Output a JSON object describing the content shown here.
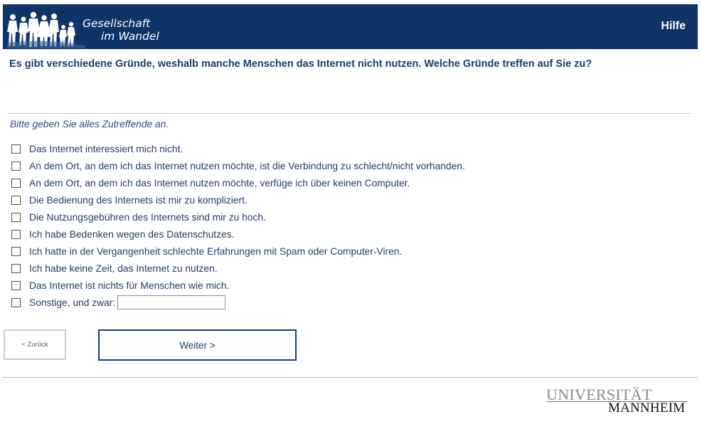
{
  "header": {
    "logo_line1": "Gesellschaft",
    "logo_line2": "im Wandel",
    "help_label": "Hilfe",
    "background_color": "#0e3367"
  },
  "question": {
    "text": "Es gibt verschiedene Gründe, weshalb manche Menschen das Internet nicht nutzen. Welche Gründe treffen auf Sie zu?",
    "hint": "Bitte geben Sie alles Zutreffende an."
  },
  "options": [
    {
      "label": "Das Internet interessiert mich nicht.",
      "checked": false
    },
    {
      "label": "An dem Ort, an dem ich das Internet nutzen möchte, ist die Verbindung zu schlecht/nicht vorhanden.",
      "checked": false
    },
    {
      "label": "An dem Ort, an dem ich das Internet nutzen möchte, verfüge ich über keinen Computer.",
      "checked": false
    },
    {
      "label": "Die Bedienung des Internets ist mir zu kompliziert.",
      "checked": false
    },
    {
      "label": "Die Nutzungsgebühren des Internets sind mir zu hoch.",
      "checked": false
    },
    {
      "label": "Ich habe Bedenken wegen des Datenschutzes.",
      "checked": false
    },
    {
      "label": "Ich hatte in der Vergangenheit schlechte Erfahrungen mit Spam oder Computer-Viren.",
      "checked": false
    },
    {
      "label": "Ich habe keine Zeit, das Internet zu nutzen.",
      "checked": false
    },
    {
      "label": "Das Internet ist nichts für Menschen wie mich.",
      "checked": false
    },
    {
      "label": "Sonstige, und zwar:",
      "checked": false,
      "input_value": ""
    }
  ],
  "navigation": {
    "back_label": "< Zurück",
    "next_label": "Weiter >"
  },
  "footer": {
    "university_top": "UNIVERSITÄT",
    "university_bottom": "MANNHEIM"
  }
}
